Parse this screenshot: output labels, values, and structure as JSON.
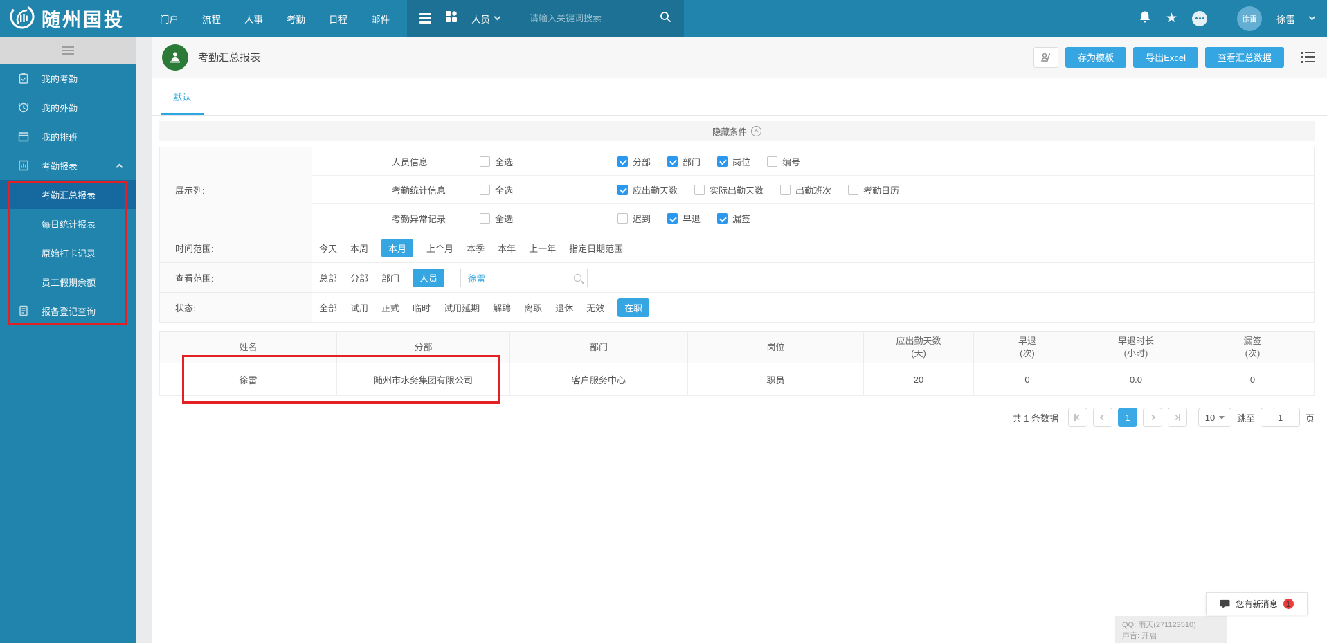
{
  "colors": {
    "navbar": "#2184ad",
    "nav_dark": "#1d7397",
    "sidebar_active": "#16699e",
    "accent": "#36a6e2",
    "checkbox": "#2b98ef",
    "title_icon_green": "#2b7a38",
    "annotation_red": "#e32024"
  },
  "navbar": {
    "brand": "随州国投",
    "menu": [
      {
        "label": "门户"
      },
      {
        "label": "流程"
      },
      {
        "label": "人事"
      },
      {
        "label": "考勤"
      },
      {
        "label": "日程"
      },
      {
        "label": "邮件"
      }
    ],
    "scope": "人员",
    "search_placeholder": "请输入关键词搜索",
    "avatar_text": "徐雷",
    "user_name": "徐雷"
  },
  "sidebar": {
    "items": [
      {
        "label": "我的考勤"
      },
      {
        "label": "我的外勤"
      },
      {
        "label": "我的排班"
      },
      {
        "label": "考勤报表",
        "expanded": true
      },
      {
        "label": "考勤汇总报表",
        "active": true
      },
      {
        "label": "每日统计报表"
      },
      {
        "label": "原始打卡记录"
      },
      {
        "label": "员工假期余额"
      },
      {
        "label": "报备登记查询"
      }
    ]
  },
  "header": {
    "title": "考勤汇总报表",
    "tab": "默认",
    "save_template": "存为模板",
    "export_excel": "导出Excel",
    "view_summary": "查看汇总数据"
  },
  "filters": {
    "hide_label": "隐藏条件",
    "display_label": "展示列:",
    "select_all": "全选",
    "display_rows": [
      {
        "name": "人员信息",
        "options": [
          {
            "label": "分部",
            "checked": true
          },
          {
            "label": "部门",
            "checked": true
          },
          {
            "label": "岗位",
            "checked": true
          },
          {
            "label": "编号",
            "checked": false
          }
        ]
      },
      {
        "name": "考勤统计信息",
        "options": [
          {
            "label": "应出勤天数",
            "checked": true
          },
          {
            "label": "实际出勤天数",
            "checked": false
          },
          {
            "label": "出勤班次",
            "checked": false
          },
          {
            "label": "考勤日历",
            "checked": false
          }
        ]
      },
      {
        "name": "考勤异常记录",
        "options": [
          {
            "label": "迟到",
            "checked": false
          },
          {
            "label": "早退",
            "checked": true
          },
          {
            "label": "漏签",
            "checked": true
          }
        ]
      }
    ],
    "time_range": {
      "label": "时间范围:",
      "options": [
        {
          "label": "今天"
        },
        {
          "label": "本周"
        },
        {
          "label": "本月",
          "selected": true
        },
        {
          "label": "上个月"
        },
        {
          "label": "本季"
        },
        {
          "label": "本年"
        },
        {
          "label": "上一年"
        },
        {
          "label": "指定日期范围"
        }
      ]
    },
    "view_scope": {
      "label": "查看范围:",
      "options": [
        {
          "label": "总部"
        },
        {
          "label": "分部"
        },
        {
          "label": "部门"
        },
        {
          "label": "人员",
          "selected": true
        }
      ],
      "search_value": "徐雷"
    },
    "status": {
      "label": "状态:",
      "options": [
        {
          "label": "全部"
        },
        {
          "label": "试用"
        },
        {
          "label": "正式"
        },
        {
          "label": "临时"
        },
        {
          "label": "试用延期"
        },
        {
          "label": "解聘"
        },
        {
          "label": "离职"
        },
        {
          "label": "退休"
        },
        {
          "label": "无效"
        },
        {
          "label": "在职",
          "selected": true
        }
      ]
    }
  },
  "table": {
    "columns": [
      {
        "title": "姓名"
      },
      {
        "title": "分部"
      },
      {
        "title": "部门"
      },
      {
        "title": "岗位"
      },
      {
        "title": "应出勤天数",
        "unit": "(天)"
      },
      {
        "title": "早退",
        "unit": "(次)"
      },
      {
        "title": "早退时长",
        "unit": "(小时)"
      },
      {
        "title": "漏签",
        "unit": "(次)"
      }
    ],
    "rows": [
      [
        "徐雷",
        "随州市水务集团有限公司",
        "客户服务中心",
        "职员",
        "20",
        "0",
        "0.0",
        "0"
      ]
    ]
  },
  "pagination": {
    "total": "共 1 条数据",
    "page": "1",
    "size": "10",
    "jump": "跳至",
    "jump_value": "1",
    "unit": "页"
  },
  "messenger": {
    "text": "您有新消息",
    "badge": "1"
  },
  "qq_overlay": {
    "line1": "QQ: 雨天(271123510)",
    "line2": "声音: 开启"
  }
}
